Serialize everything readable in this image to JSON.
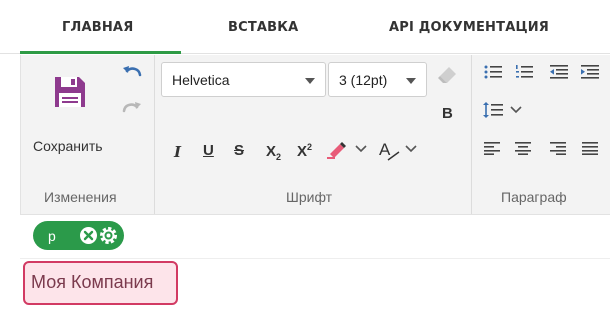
{
  "tabs": [
    {
      "label": "ГЛАВНАЯ",
      "active": true
    },
    {
      "label": "ВСТАВКА",
      "active": false
    },
    {
      "label": "API ДОКУМЕНТАЦИЯ",
      "active": false
    }
  ],
  "ribbon": {
    "changes_group": {
      "title": "Изменения",
      "save_label": "Сохранить"
    },
    "font_group": {
      "title": "Шрифт",
      "font_family": "Helvetica",
      "font_size": "3 (12pt)",
      "bold_label": "B",
      "italic_label": "I",
      "underline_label": "U",
      "strike_label": "S",
      "subscript_label": "X",
      "subscript_mark": "2",
      "superscript_label": "X",
      "superscript_mark": "2",
      "font_color_label": "A"
    },
    "paragraph_group": {
      "title": "Параграф"
    }
  },
  "editor": {
    "tag_label": "p",
    "company_text": "Моя Компания"
  },
  "colors": {
    "accent": "#2e9b45",
    "save_icon": "#8e3a8e",
    "highlight_border": "#d23a63",
    "highlight_fill": "#fde4ea"
  },
  "icons": [
    "save-icon",
    "undo-icon",
    "redo-icon",
    "eraser-icon",
    "highlighter-icon",
    "font-color-icon",
    "bullet-list-icon",
    "numbered-list-icon",
    "indent-icon",
    "line-spacing-icon",
    "align-left-icon",
    "align-center-icon",
    "align-right-icon",
    "align-justify-icon",
    "remove-tag-icon",
    "tag-settings-icon"
  ]
}
